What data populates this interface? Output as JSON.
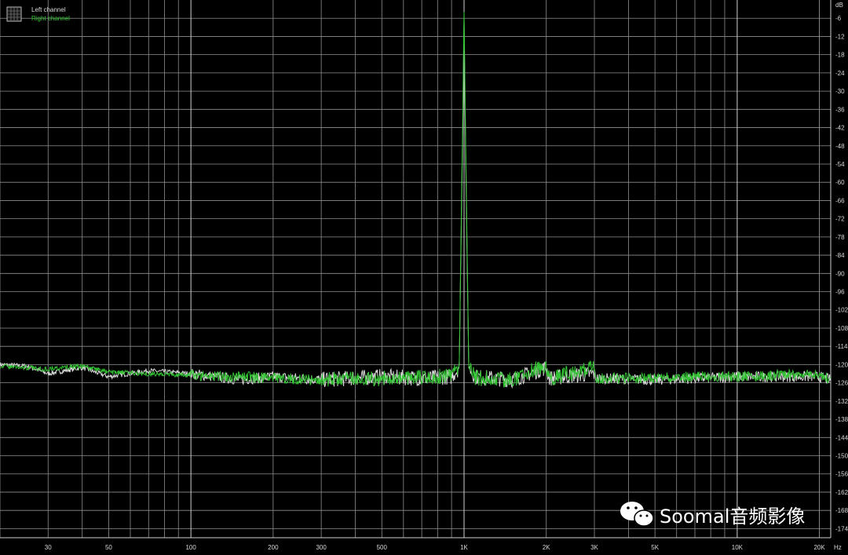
{
  "chart_data": {
    "type": "line",
    "x_scale": "log",
    "xlim": [
      20,
      22000
    ],
    "ylim": [
      -177,
      0
    ],
    "grid": true,
    "y_unit": "dB",
    "x_unit": "Hz",
    "y_ticks": [
      "-6",
      "-12",
      "-18",
      "-24",
      "-30",
      "-36",
      "-42",
      "-48",
      "-54",
      "-60",
      "-66",
      "-72",
      "-78",
      "-84",
      "-90",
      "-96",
      "-102",
      "-108",
      "-114",
      "-120",
      "-126",
      "-132",
      "-138",
      "-144",
      "-150",
      "-156",
      "-162",
      "-168",
      "-174"
    ],
    "x_ticks": [
      {
        "value": 30,
        "label": "30"
      },
      {
        "value": 50,
        "label": "50"
      },
      {
        "value": 100,
        "label": "100"
      },
      {
        "value": 200,
        "label": "200"
      },
      {
        "value": 300,
        "label": "300"
      },
      {
        "value": 500,
        "label": "500"
      },
      {
        "value": 1000,
        "label": "1K"
      },
      {
        "value": 2000,
        "label": "2K"
      },
      {
        "value": 3000,
        "label": "3K"
      },
      {
        "value": 5000,
        "label": "5K"
      },
      {
        "value": 10000,
        "label": "10K"
      },
      {
        "value": 20000,
        "label": "20K"
      }
    ],
    "legend": {
      "placement": "top-left"
    },
    "series": [
      {
        "name": "Left channel",
        "color": "#d9d9d9",
        "points": [
          [
            20,
            -120
          ],
          [
            25,
            -120.5
          ],
          [
            30,
            -123
          ],
          [
            40,
            -121
          ],
          [
            50,
            -124
          ],
          [
            70,
            -122
          ],
          [
            100,
            -123
          ],
          [
            150,
            -125
          ],
          [
            200,
            -124
          ],
          [
            300,
            -125
          ],
          [
            500,
            -124
          ],
          [
            700,
            -124.5
          ],
          [
            900,
            -124
          ],
          [
            960,
            -121
          ],
          [
            990,
            -40
          ],
          [
            1000,
            -5
          ],
          [
            1010,
            -40
          ],
          [
            1040,
            -121
          ],
          [
            1100,
            -124
          ],
          [
            1500,
            -125
          ],
          [
            2000,
            -121
          ],
          [
            2050,
            -124.5
          ],
          [
            3000,
            -123
          ],
          [
            3050,
            -124.5
          ],
          [
            5000,
            -125
          ],
          [
            7000,
            -124.5
          ],
          [
            10000,
            -124
          ],
          [
            15000,
            -124
          ],
          [
            20000,
            -124
          ],
          [
            22000,
            -125
          ]
        ]
      },
      {
        "name": "Right channel",
        "color": "#33c533",
        "points": [
          [
            20,
            -120.5
          ],
          [
            25,
            -121
          ],
          [
            30,
            -121.5
          ],
          [
            40,
            -120.5
          ],
          [
            50,
            -122.5
          ],
          [
            70,
            -123
          ],
          [
            100,
            -123.5
          ],
          [
            150,
            -124
          ],
          [
            200,
            -124.5
          ],
          [
            300,
            -125
          ],
          [
            500,
            -124.5
          ],
          [
            700,
            -124
          ],
          [
            900,
            -124
          ],
          [
            960,
            -120.5
          ],
          [
            990,
            -35
          ],
          [
            1000,
            -3
          ],
          [
            1010,
            -35
          ],
          [
            1040,
            -120.5
          ],
          [
            1100,
            -124.5
          ],
          [
            1500,
            -125
          ],
          [
            2000,
            -120
          ],
          [
            2050,
            -124.5
          ],
          [
            3000,
            -121
          ],
          [
            3050,
            -124.5
          ],
          [
            5000,
            -124.5
          ],
          [
            7000,
            -124
          ],
          [
            10000,
            -124
          ],
          [
            15000,
            -123.5
          ],
          [
            20000,
            -123.5
          ],
          [
            22000,
            -125
          ]
        ]
      }
    ]
  },
  "y_axis_unit_label": "dB",
  "x_axis_unit_label": "Hz",
  "legend_items": [
    {
      "label": "Left channel",
      "color": "#d9d9d9"
    },
    {
      "label": "Right channel",
      "color": "#33c533"
    }
  ],
  "watermark": {
    "text": "Soomal音频影像",
    "icon": "wechat-icon"
  }
}
